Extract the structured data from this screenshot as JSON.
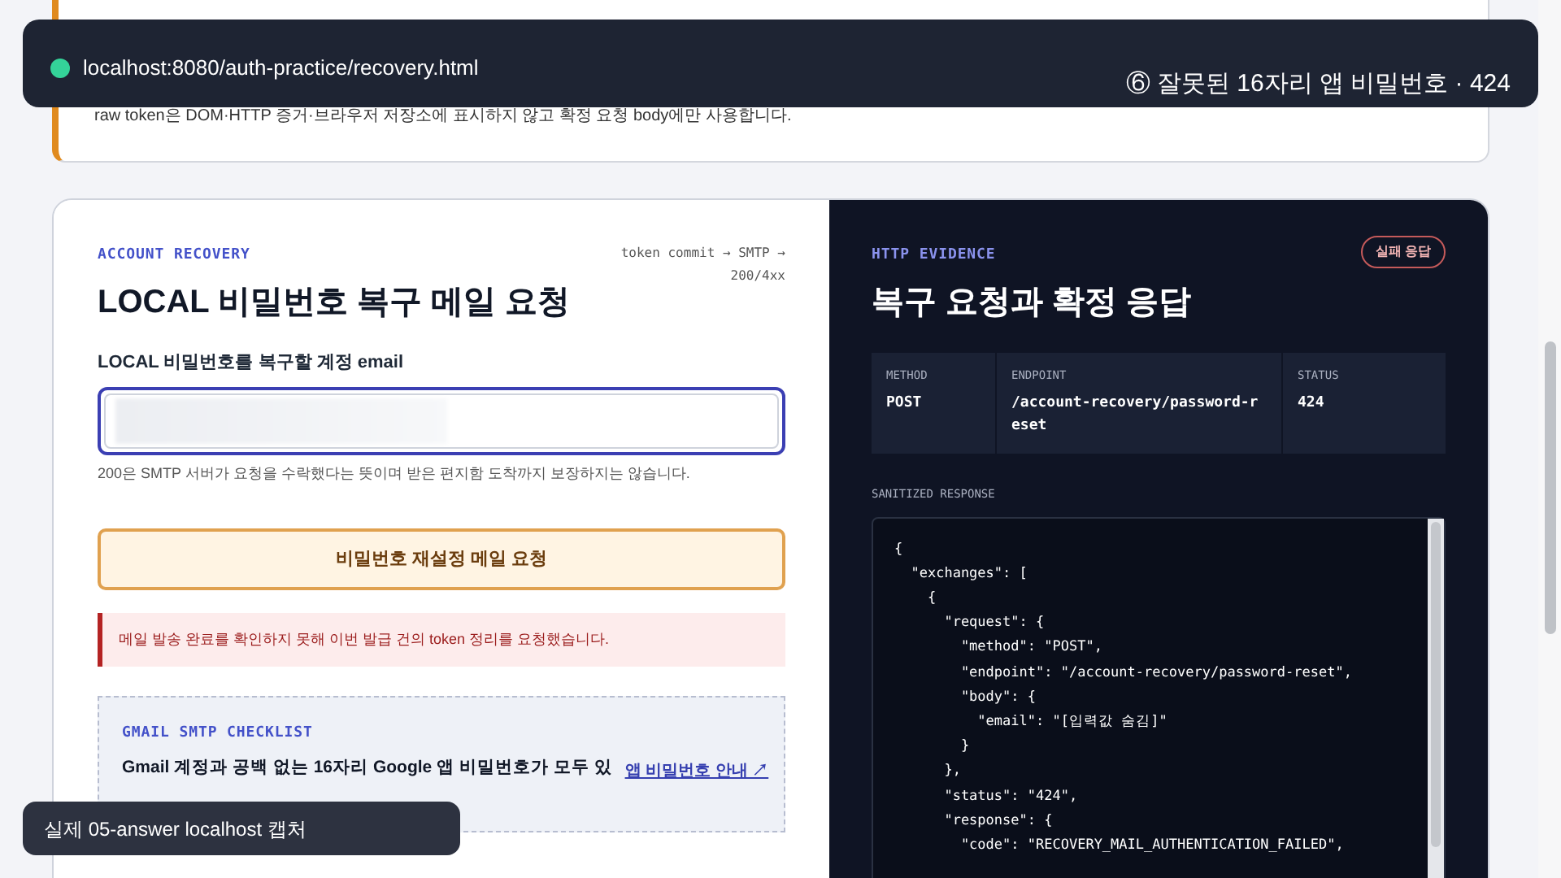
{
  "overlay_top": {
    "url": "localhost:8080/auth-practice/recovery.html",
    "caption": "⑥ 잘못된 16자리 앱 비밀번호 · 424"
  },
  "top_card": {
    "note": "raw token은 DOM·HTTP 증거·브라우저 저장소에 표시하지 않고 확정 요청 body에만 사용합니다."
  },
  "form": {
    "eyebrow": "ACCOUNT RECOVERY",
    "flow": "token commit → SMTP → 200/4xx",
    "title": "LOCAL 비밀번호 복구 메일 요청",
    "email_label": "LOCAL 비밀번호를 복구할 계정 email",
    "help": "200은 SMTP 서버가 요청을 수락했다는 뜻이며 받은 편지함 도착까지 보장하지는 않습니다.",
    "submit": "비밀번호 재설정 메일 요청",
    "alert": "메일 발송 완료를 확인하지 못해 이번 발급 건의 token 정리를 요청했습니다.",
    "checklist": {
      "eyebrow": "GMAIL SMTP CHECKLIST",
      "text": "Gmail 계정과 공백 없는 16자리 Google 앱 비밀번호가 모두 있",
      "link": "앱 비밀번호 안내 ↗"
    }
  },
  "evidence": {
    "eyebrow": "HTTP EVIDENCE",
    "badge": "실패 응답",
    "title": "복구 요청과 확정 응답",
    "fields": [
      {
        "label": "METHOD",
        "value": "POST"
      },
      {
        "label": "ENDPOINT",
        "value": "/account-recovery/password-reset"
      },
      {
        "label": "STATUS",
        "value": "424"
      }
    ],
    "response_label": "SANITIZED RESPONSE",
    "response_lines": [
      "{",
      "  \"exchanges\": [",
      "    {",
      "      \"request\": {",
      "        \"method\": \"POST\",",
      "        \"endpoint\": \"/account-recovery/password-reset\",",
      "        \"body\": {",
      "          \"email\": \"[입력값 숨김]\"",
      "        }",
      "      },",
      "      \"status\": \"424\",",
      "      \"response\": {",
      "        \"code\": \"RECOVERY_MAIL_AUTHENTICATION_FAILED\","
    ]
  },
  "caption_bottom": "실제 05-answer localhost 캡처"
}
